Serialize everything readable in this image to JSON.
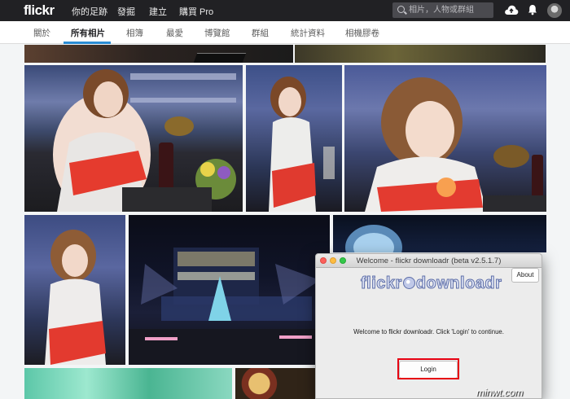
{
  "topbar": {
    "logo": "flickr",
    "nav": [
      "你的足跡",
      "發掘",
      "建立",
      "購買 Pro"
    ],
    "search_placeholder": "相片，人物或群組"
  },
  "subnav": {
    "tabs": [
      "關於",
      "所有相片",
      "相簿",
      "最愛",
      "博覽館",
      "群組",
      "統計資料",
      "相機膠卷"
    ],
    "active": "所有相片"
  },
  "dialog": {
    "title": "Welcome - flickr downloadr (beta v2.5.1.7)",
    "about_label": "About",
    "app_logo": "flickr downloadr",
    "app_logo_a": "flickr",
    "app_logo_b": "downloadr",
    "welcome_text": "Welcome to flickr downloadr. Click 'Login' to continue.",
    "login_label": "Login"
  },
  "watermark": "minwt.com",
  "colors": {
    "topbar": "#212124",
    "accent": "#2a8cd4",
    "highlight": "#e60012"
  },
  "icons": [
    "search-icon",
    "upload-cloud-icon",
    "bell-icon",
    "avatar"
  ]
}
